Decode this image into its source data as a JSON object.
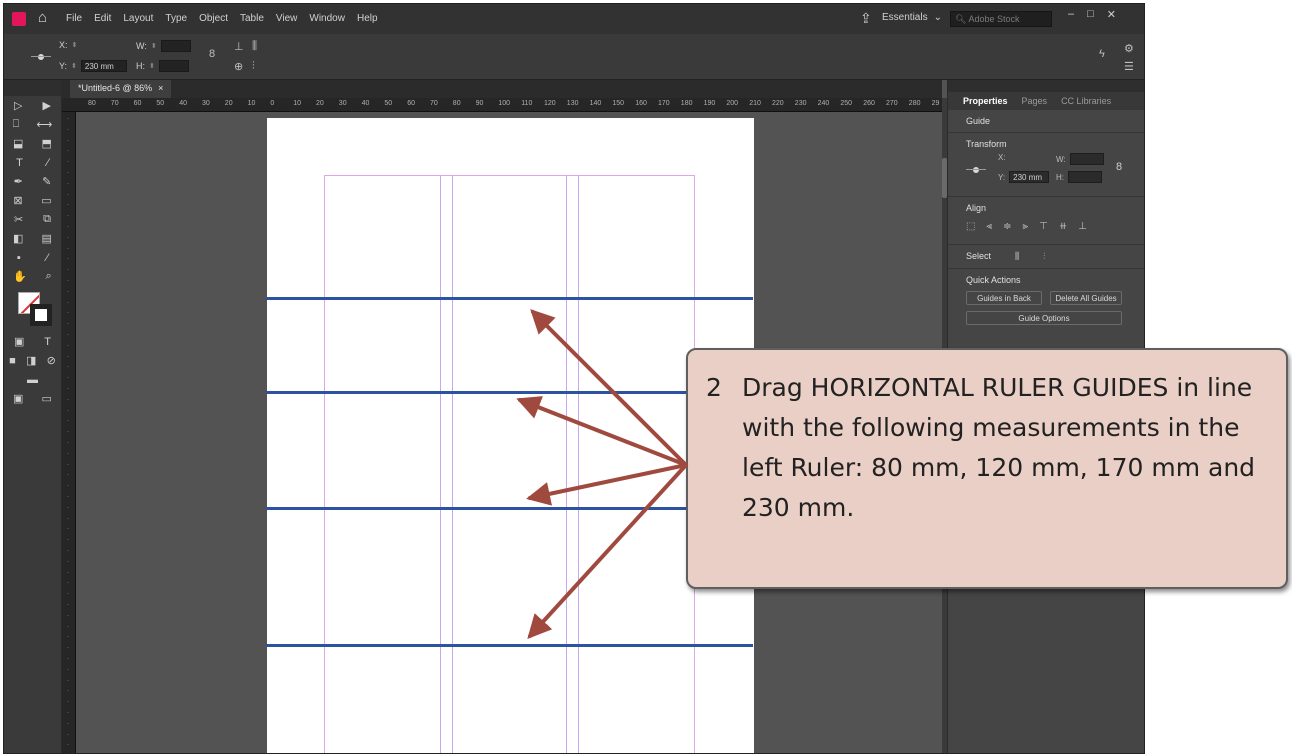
{
  "menu": {
    "items": [
      "File",
      "Edit",
      "Layout",
      "Type",
      "Object",
      "Table",
      "View",
      "Window",
      "Help"
    ],
    "workspace_label": "Essentials",
    "search_placeholder": "Adobe Stock"
  },
  "control_bar": {
    "x_label": "X:",
    "y_label": "Y:",
    "y_value": "230 mm",
    "w_label": "W:",
    "h_label": "H:"
  },
  "document": {
    "tab_title": "*Untitled-6 @ 86%",
    "close_glyph": "×"
  },
  "ruler": {
    "horizontal_ticks": [
      "80",
      "70",
      "60",
      "50",
      "40",
      "30",
      "20",
      "10",
      "0",
      "10",
      "20",
      "30",
      "40",
      "50",
      "60",
      "70",
      "80",
      "90",
      "100",
      "110",
      "120",
      "130",
      "140",
      "150",
      "160",
      "170",
      "180",
      "190",
      "200",
      "210",
      "220",
      "230",
      "240",
      "250",
      "260",
      "270",
      "280",
      "29"
    ]
  },
  "properties_panel": {
    "tabs": [
      "Properties",
      "Pages",
      "CC Libraries"
    ],
    "selection_type": "Guide",
    "transform_label": "Transform",
    "x_label": "X:",
    "y_label": "Y:",
    "y_value": "230 mm",
    "w_label": "W:",
    "h_label": "H:",
    "align_label": "Align",
    "select_label": "Select",
    "quick_actions_label": "Quick Actions",
    "guides_in_back": "Guides in Back",
    "delete_all_guides": "Delete All Guides",
    "guide_options": "Guide Options"
  },
  "callout": {
    "step": "2",
    "text": "Drag HORIZONTAL RULER GUIDES in line with the following measurements in the left Ruler: 80 mm, 120 mm, 170 mm and 230 mm."
  },
  "colors": {
    "guide": "#2d52a0",
    "arrow": "#a04a3f",
    "callout_fill": "#e9cfc5",
    "margin": "#e0a6e8",
    "column": "#c7a8ee"
  }
}
